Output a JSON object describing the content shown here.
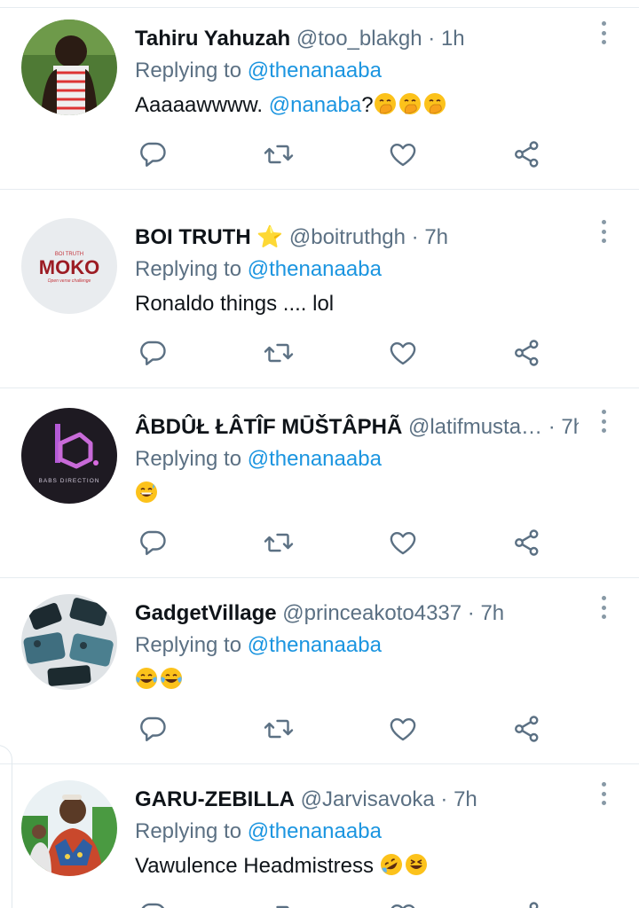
{
  "tweets": [
    {
      "name": "BOI TRUTH ⭐",
      "handle": "@boitruthgh",
      "time": "7h",
      "replying_prefix": "Replying to ",
      "replying_to": "@thenanaaba",
      "text": "Ronaldo things .... lol",
      "avatar_text": "MOKO",
      "avatar_small": "BOI TRUTH",
      "avatar_sub": "Open verse challenge"
    },
    {
      "name": "ÂBDÛŁ ŁÂTÎF MŪŠTÂPHÃ",
      "handle": "@latifmusta…",
      "time": "7h",
      "replying_prefix": "Replying to ",
      "replying_to": "@thenanaaba",
      "emoji": [
        "grinning-sweat"
      ],
      "avatar_text": "BABS DIRECTION"
    },
    {
      "name": "GadgetVillage",
      "handle": "@princeakoto4337",
      "time": "7h",
      "replying_prefix": "Replying to ",
      "replying_to": "@thenanaaba",
      "emoji": [
        "tears-of-joy",
        "tears-of-joy"
      ]
    },
    {
      "name": "GARU-ZEBILLA",
      "handle": "@Jarvisavoka",
      "time": "7h",
      "replying_prefix": "Replying to ",
      "replying_to": "@thenanaaba",
      "text": "Vawulence Headmistress ",
      "emoji": [
        "rofl",
        "laughing"
      ]
    },
    {
      "name": "Tahiru Yahuzah",
      "handle": "@too_blakgh",
      "time": "1h",
      "replying_prefix": "Replying to ",
      "replying_to": "@thenanaaba",
      "text": "Aaaaawwww. ",
      "mention": "@nanaba",
      "text_after": "?",
      "emoji": [
        "hand-over-mouth",
        "hand-over-mouth",
        "hand-over-mouth"
      ]
    }
  ],
  "separator": " · ",
  "colors": {
    "text": "#0f1419",
    "secondary": "#5b7083",
    "link": "#1b95e0",
    "border": "#e6ecf0",
    "icon": "#5b7083"
  },
  "icons": [
    "reply-icon",
    "retweet-icon",
    "like-icon",
    "share-icon",
    "more-icon"
  ]
}
